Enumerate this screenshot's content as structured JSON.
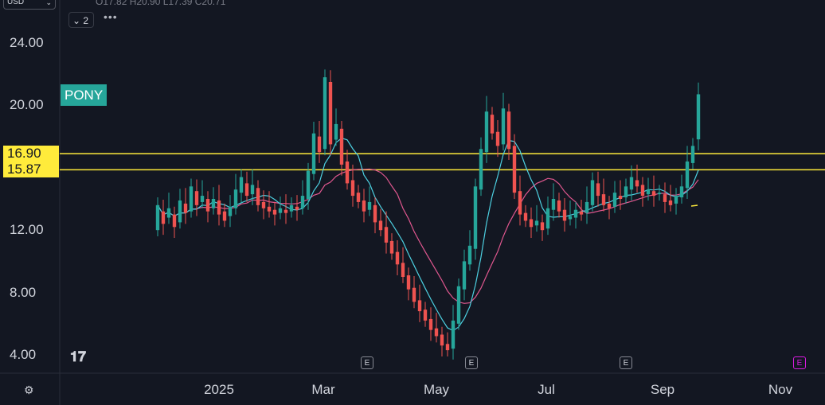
{
  "header": {
    "currency": "USD",
    "ohlc": "O17.82 H20.90 L17.39 C20.71",
    "indicator_count": "2",
    "more": "•••"
  },
  "symbol_tag": "PONY",
  "price_lines": [
    "16.90",
    "15.87"
  ],
  "badges": {
    "earnings": "E",
    "dividend": "E"
  },
  "colors": {
    "up": "#26a69a",
    "down": "#ef5350",
    "ma_fast": "#4dd0e1",
    "ma_slow": "#e0578f",
    "level": "#ffeb3b"
  },
  "chart_data": {
    "type": "candlestick",
    "y_ticks": [
      "24.00",
      "20.00",
      "12.00",
      "8.00",
      "4.00"
    ],
    "y_tick_values": [
      24,
      20,
      12,
      8,
      4
    ],
    "x_ticks": [
      "2025",
      "Mar",
      "May",
      "Jul",
      "Sep",
      "Nov"
    ],
    "ylim": [
      3.2,
      26.2
    ],
    "horizontal_levels": [
      16.9,
      15.87
    ],
    "grid": false,
    "series": [
      {
        "points": [
          [
            12.0,
            13.6
          ],
          [
            13.2,
            12.4
          ],
          [
            12.8,
            13.4
          ],
          [
            13.0,
            12.2
          ],
          [
            12.5,
            13.9
          ],
          [
            13.7,
            13.1
          ],
          [
            13.2,
            14.8
          ],
          [
            14.5,
            13.6
          ],
          [
            13.8,
            14.2
          ],
          [
            14.0,
            13.2
          ],
          [
            13.4,
            14.0
          ],
          [
            13.9,
            13.0
          ],
          [
            13.2,
            12.6
          ],
          [
            12.9,
            13.5
          ],
          [
            13.4,
            14.6
          ],
          [
            14.4,
            15.4
          ],
          [
            15.0,
            14.2
          ],
          [
            14.3,
            14.9
          ],
          [
            14.7,
            13.6
          ],
          [
            13.8,
            13.4
          ],
          [
            13.5,
            13.2
          ],
          [
            13.3,
            13.0
          ],
          [
            13.1,
            13.4
          ],
          [
            13.3,
            13.1
          ],
          [
            13.2,
            13.6
          ],
          [
            13.5,
            13.3
          ],
          [
            13.4,
            14.2
          ],
          [
            14.0,
            15.8
          ],
          [
            15.6,
            18.2
          ],
          [
            18.0,
            17.0
          ],
          [
            17.2,
            21.8
          ],
          [
            21.5,
            17.5
          ],
          [
            17.8,
            18.8
          ],
          [
            18.5,
            16.2
          ],
          [
            16.4,
            15.0
          ],
          [
            15.2,
            14.2
          ],
          [
            14.4,
            13.8
          ],
          [
            13.9,
            13.2
          ],
          [
            13.3,
            13.8
          ],
          [
            13.6,
            12.5
          ],
          [
            12.6,
            12.0
          ],
          [
            12.2,
            11.2
          ],
          [
            11.3,
            10.5
          ],
          [
            10.6,
            9.8
          ],
          [
            9.9,
            9.0
          ],
          [
            9.1,
            8.2
          ],
          [
            8.3,
            7.4
          ],
          [
            7.5,
            6.8
          ],
          [
            6.9,
            6.2
          ],
          [
            6.3,
            5.6
          ],
          [
            5.7,
            5.2
          ],
          [
            5.3,
            4.6
          ],
          [
            4.7,
            4.3
          ],
          [
            4.4,
            6.2
          ],
          [
            6.0,
            8.4
          ],
          [
            8.2,
            10.0
          ],
          [
            9.8,
            11.0
          ],
          [
            10.8,
            14.8
          ],
          [
            14.6,
            17.2
          ],
          [
            17.0,
            19.6
          ],
          [
            19.4,
            18.2
          ],
          [
            18.3,
            17.4
          ],
          [
            17.5,
            19.8
          ],
          [
            19.6,
            17.2
          ],
          [
            17.4,
            14.4
          ],
          [
            14.5,
            13.0
          ],
          [
            13.1,
            12.6
          ],
          [
            12.7,
            12.2
          ],
          [
            12.3,
            12.6
          ],
          [
            12.5,
            12.0
          ],
          [
            12.1,
            13.4
          ],
          [
            13.3,
            14.0
          ],
          [
            13.9,
            13.2
          ],
          [
            13.3,
            12.6
          ],
          [
            12.7,
            12.9
          ],
          [
            12.8,
            13.3
          ],
          [
            13.2,
            13.0
          ],
          [
            13.1,
            13.8
          ],
          [
            13.6,
            15.2
          ],
          [
            15.0,
            14.2
          ],
          [
            14.3,
            13.6
          ],
          [
            13.7,
            13.4
          ],
          [
            13.5,
            14.4
          ],
          [
            14.2,
            14.0
          ],
          [
            14.1,
            14.8
          ],
          [
            14.6,
            15.4
          ],
          [
            15.2,
            14.8
          ],
          [
            14.9,
            14.2
          ],
          [
            14.3,
            14.6
          ],
          [
            14.5,
            14.2
          ],
          [
            14.3,
            14.4
          ],
          [
            14.3,
            13.8
          ],
          [
            13.9,
            13.6
          ],
          [
            13.7,
            14.2
          ],
          [
            14.1,
            14.8
          ],
          [
            14.7,
            16.4
          ],
          [
            16.3,
            17.4
          ],
          [
            17.82,
            20.71
          ]
        ]
      }
    ]
  }
}
